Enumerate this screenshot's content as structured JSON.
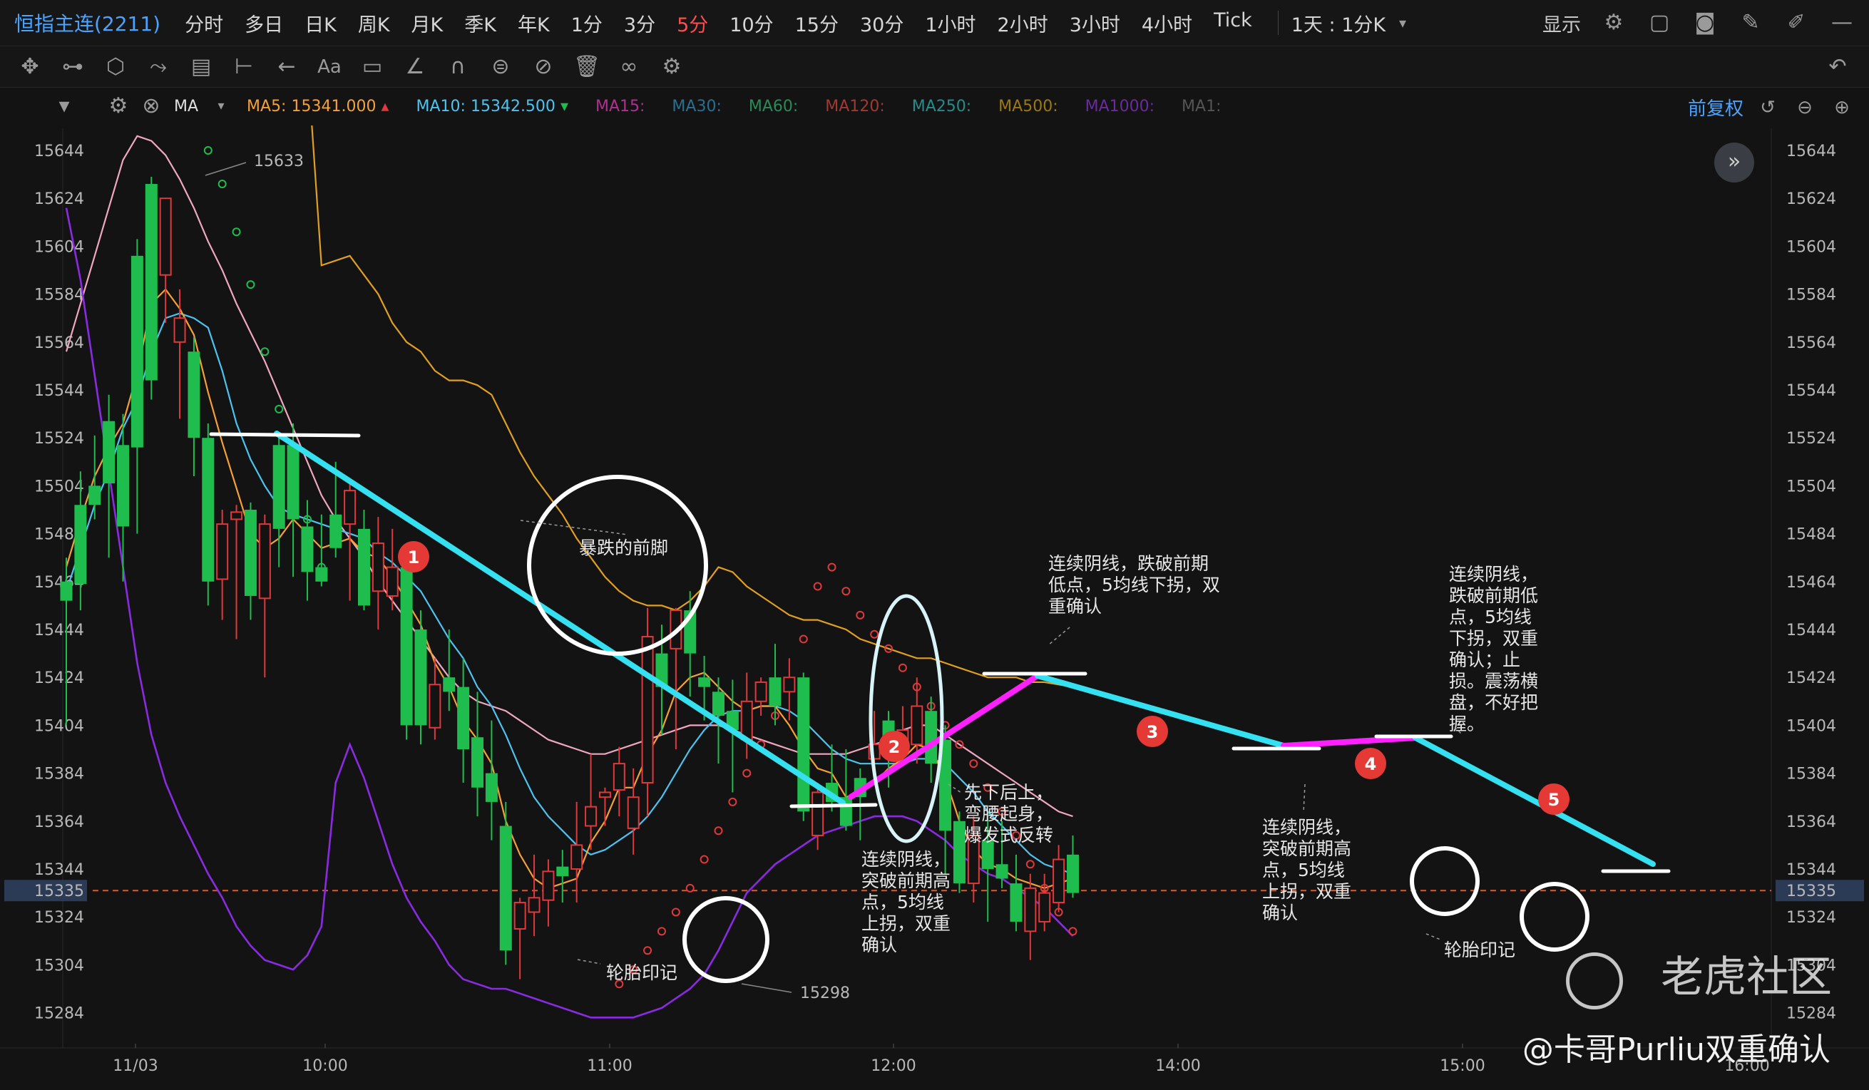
{
  "header": {
    "title": "恒指主连(2211)",
    "timeframes": [
      "分时",
      "多日",
      "日K",
      "周K",
      "月K",
      "季K",
      "年K",
      "1分",
      "3分",
      "5分",
      "10分",
      "15分",
      "30分",
      "1小时",
      "2小时",
      "3小时",
      "4小时",
      "Tick"
    ],
    "active_timeframe": "5分",
    "period_select": "1天 : 1分K",
    "display_label": "显示"
  },
  "mabar": {
    "ma_label": "MA",
    "ma5_label": "MA5:",
    "ma5_value": "15341.000",
    "ma10_label": "MA10:",
    "ma10_value": "15342.500",
    "others": [
      "MA15:",
      "MA30:",
      "MA60:",
      "MA120:",
      "MA250:",
      "MA500:",
      "MA1000:",
      "MA1:"
    ],
    "fuquan": "前复权"
  },
  "colors": {
    "up": "#e0393b",
    "down": "#1ebd4d",
    "ma5": "#f5a136",
    "ma10": "#4dc3f0",
    "ma_pink": "#f0a8c0",
    "ma_gold": "#e0a020",
    "ma_purple": "#8a2be2",
    "trend_cyan": "#35e0f0",
    "trend_magenta": "#ff20ff",
    "price_line": "#e0582a"
  },
  "chart_data": {
    "type": "candlestick",
    "y_ticks": [
      15644,
      15624,
      15604,
      15584,
      15564,
      15544,
      15524,
      15504,
      15484,
      15464,
      15444,
      15424,
      15404,
      15384,
      15364,
      15344,
      15324,
      15304,
      15284
    ],
    "x_ticks": [
      "11/03",
      "10:00",
      "11:00",
      "12:00",
      "14:00",
      "15:00",
      "16:00"
    ],
    "current_price": 15335,
    "current_price_label": "15335",
    "ylim": [
      15276,
      15652
    ],
    "bars": 72,
    "max_label": "15633",
    "min_label": "15298",
    "candles": [
      [
        15464,
        15456,
        15474,
        15404
      ],
      [
        15496,
        15463,
        15510,
        15452
      ],
      [
        15504,
        15496,
        15525,
        15490
      ],
      [
        15531,
        15505,
        15542,
        15474
      ],
      [
        15521,
        15487,
        15534,
        15464
      ],
      [
        15600,
        15520,
        15607,
        15484
      ],
      [
        15630,
        15548,
        15633,
        15540
      ],
      [
        15592,
        15624,
        15624,
        15572
      ],
      [
        15564,
        15574,
        15586,
        15532
      ],
      [
        15560,
        15524,
        15566,
        15508
      ],
      [
        15524,
        15464,
        15530,
        15454
      ],
      [
        15465,
        15488,
        15494,
        15448
      ],
      [
        15490,
        15493,
        15496,
        15440
      ],
      [
        15494,
        15458,
        15497,
        15448
      ],
      [
        15457,
        15488,
        15492,
        15424
      ],
      [
        15521,
        15486,
        15524,
        15470
      ],
      [
        15521,
        15490,
        15530,
        15466
      ],
      [
        15487,
        15468,
        15498,
        15456
      ],
      [
        15470,
        15464,
        15492,
        15462
      ],
      [
        15492,
        15478,
        15514,
        15474
      ],
      [
        15488,
        15502,
        15507,
        15456
      ],
      [
        15486,
        15454,
        15494,
        15452
      ],
      [
        15460,
        15480,
        15491,
        15444
      ],
      [
        15458,
        15470,
        15486,
        15452
      ],
      [
        15470,
        15404,
        15480,
        15398
      ],
      [
        15444,
        15404,
        15452,
        15396
      ],
      [
        15403,
        15421,
        15432,
        15398
      ],
      [
        15424,
        15418,
        15444,
        15410
      ],
      [
        15420,
        15394,
        15432,
        15380
      ],
      [
        15399,
        15378,
        15418,
        15366
      ],
      [
        15384,
        15372,
        15406,
        15356
      ],
      [
        15362,
        15310,
        15372,
        15304
      ],
      [
        15319,
        15330,
        15332,
        15298
      ],
      [
        15326,
        15332,
        15350,
        15316
      ],
      [
        15331,
        15343,
        15348,
        15320
      ],
      [
        15345,
        15341,
        15352,
        15330
      ],
      [
        15344,
        15354,
        15372,
        15330
      ],
      [
        15362,
        15370,
        15392,
        15352
      ],
      [
        15374,
        15376,
        15378,
        15362
      ],
      [
        15377,
        15388,
        15395,
        15366
      ],
      [
        15361,
        15374,
        15386,
        15350
      ],
      [
        15380,
        15441,
        15453,
        15366
      ],
      [
        15434,
        15420,
        15446,
        15400
      ],
      [
        15436,
        15452,
        15453,
        15394
      ],
      [
        15452,
        15434,
        15460,
        15416
      ],
      [
        15424,
        15420,
        15433,
        15406
      ],
      [
        15418,
        15408,
        15424,
        15388
      ],
      [
        15410,
        15402,
        15423,
        15376
      ],
      [
        15398,
        15414,
        15426,
        15390
      ],
      [
        15414,
        15422,
        15424,
        15408
      ],
      [
        15424,
        15412,
        15438,
        15404
      ],
      [
        15418,
        15424,
        15432,
        15406
      ],
      [
        15424,
        15368,
        15426,
        15364
      ],
      [
        15358,
        15376,
        15380,
        15352
      ],
      [
        15380,
        15372,
        15396,
        15368
      ],
      [
        15374,
        15362,
        15394,
        15360
      ],
      [
        15382,
        15374,
        15386,
        15356
      ],
      [
        15390,
        15396,
        15410,
        15380
      ],
      [
        15406,
        15392,
        15410,
        15378
      ],
      [
        15398,
        15402,
        15412,
        15392
      ],
      [
        15396,
        15412,
        15424,
        15388
      ],
      [
        15410,
        15388,
        15416,
        15380
      ],
      [
        15398,
        15360,
        15404,
        15342
      ],
      [
        15364,
        15338,
        15368,
        15334
      ],
      [
        15338,
        15358,
        15366,
        15330
      ],
      [
        15356,
        15344,
        15368,
        15322
      ],
      [
        15346,
        15340,
        15364,
        15336
      ],
      [
        15338,
        15322,
        15350,
        15318
      ],
      [
        15318,
        15336,
        15342,
        15306
      ],
      [
        15322,
        15334,
        15342,
        15318
      ],
      [
        15330,
        15348,
        15354,
        15326
      ],
      [
        15350,
        15334,
        15358,
        15332
      ]
    ],
    "lines": {
      "ma5": [
        15470,
        15490,
        15508,
        15520,
        15530,
        15551,
        15580,
        15586,
        15578,
        15567,
        15543,
        15522,
        15503,
        15484,
        15478,
        15482,
        15490,
        15484,
        15478,
        15480,
        15482,
        15476,
        15474,
        15466,
        15456,
        15446,
        15430,
        15420,
        15406,
        15398,
        15388,
        15364,
        15350,
        15340,
        15336,
        15338,
        15340,
        15355,
        15364,
        15378,
        15378,
        15392,
        15402,
        15418,
        15424,
        15426,
        15420,
        15414,
        15410,
        15412,
        15412,
        15404,
        15394,
        15386,
        15384,
        15374,
        15376,
        15380,
        15386,
        15390,
        15396,
        15394,
        15382,
        15364,
        15352,
        15346,
        15344,
        15340,
        15338,
        15336,
        15338,
        15340
      ],
      "ma10": [
        15460,
        15478,
        15496,
        15510,
        15528,
        15540,
        15560,
        15574,
        15576,
        15574,
        15570,
        15552,
        15530,
        15515,
        15504,
        15495,
        15492,
        15490,
        15488,
        15486,
        15484,
        15482,
        15476,
        15472,
        15466,
        15460,
        15450,
        15440,
        15432,
        15420,
        15412,
        15400,
        15386,
        15374,
        15366,
        15360,
        15354,
        15350,
        15352,
        15356,
        15360,
        15366,
        15374,
        15384,
        15394,
        15402,
        15408,
        15410,
        15410,
        15412,
        15412,
        15410,
        15406,
        15400,
        15394,
        15390,
        15388,
        15388,
        15388,
        15388,
        15390,
        15390,
        15388,
        15382,
        15376,
        15368,
        15362,
        15356,
        15350,
        15346,
        15344,
        15342
      ],
      "ma_pink": [
        15560,
        15580,
        15600,
        15620,
        15640,
        15650,
        15648,
        15642,
        15632,
        15620,
        15606,
        15594,
        15580,
        15568,
        15556,
        15542,
        15528,
        15514,
        15500,
        15490,
        15482,
        15474,
        15464,
        15456,
        15448,
        15440,
        15432,
        15424,
        15418,
        15414,
        15412,
        15410,
        15406,
        15402,
        15398,
        15396,
        15394,
        15392,
        15392,
        15394,
        15396,
        15398,
        15400,
        15402,
        15404,
        15404,
        15404,
        15402,
        15400,
        15398,
        15396,
        15394,
        15392,
        15392,
        15392,
        15392,
        15394,
        15396,
        15398,
        15402,
        15404,
        15404,
        15400,
        15396,
        15392,
        15388,
        15384,
        15380,
        15376,
        15372,
        15368,
        15366
      ],
      "ma_gold": [
        15700,
        15700,
        15700,
        15700,
        15700,
        15700,
        15700,
        15700,
        15700,
        15700,
        15700,
        15700,
        15700,
        15700,
        15700,
        15700,
        15700,
        15682,
        15596,
        15598,
        15600,
        15592,
        15584,
        15572,
        15564,
        15560,
        15552,
        15548,
        15548,
        15546,
        15542,
        15530,
        15518,
        15508,
        15500,
        15492,
        15482,
        15474,
        15466,
        15460,
        15456,
        15454,
        15454,
        15452,
        15456,
        15462,
        15470,
        15468,
        15462,
        15458,
        15454,
        15450,
        15448,
        15448,
        15446,
        15444,
        15440,
        15438,
        15436,
        15434,
        15432,
        15432,
        15430,
        15428,
        15426,
        15424,
        15424,
        15424,
        15422,
        15422,
        15421,
        15420
      ],
      "ma_purple": [
        15620,
        15590,
        15550,
        15510,
        15470,
        15430,
        15400,
        15380,
        15366,
        15354,
        15342,
        15332,
        15320,
        15312,
        15306,
        15304,
        15302,
        15308,
        15320,
        15380,
        15396,
        15382,
        15364,
        15346,
        15332,
        15322,
        15314,
        15304,
        15298,
        15296,
        15294,
        15294,
        15292,
        15290,
        15288,
        15286,
        15284,
        15282,
        15282,
        15282,
        15282,
        15284,
        15286,
        15290,
        15294,
        15300,
        15310,
        15322,
        15334,
        15340,
        15346,
        15350,
        15354,
        15358,
        15360,
        15362,
        15364,
        15366,
        15366,
        15366,
        15364,
        15360,
        15356,
        15350,
        15346,
        15342,
        15340,
        15336,
        15332,
        15328,
        15322,
        15316
      ],
      "sar": [
        [
          10,
          15644
        ],
        [
          11,
          15630
        ],
        [
          12,
          15610
        ],
        [
          13,
          15588
        ],
        [
          14,
          15560
        ],
        [
          15,
          15536
        ],
        [
          16,
          15510
        ],
        [
          17,
          15490
        ],
        [
          18,
          15470
        ],
        [
          39,
          15296
        ],
        [
          40,
          15302
        ],
        [
          41,
          15310
        ],
        [
          42,
          15318
        ],
        [
          43,
          15326
        ],
        [
          44,
          15336
        ],
        [
          45,
          15348
        ],
        [
          46,
          15360
        ],
        [
          47,
          15372
        ],
        [
          48,
          15384
        ],
        [
          49,
          15396
        ],
        [
          50,
          15408
        ],
        [
          51,
          15422
        ],
        [
          52,
          15440
        ],
        [
          53,
          15462
        ],
        [
          54,
          15470
        ],
        [
          55,
          15460
        ],
        [
          56,
          15450
        ],
        [
          57,
          15442
        ],
        [
          58,
          15436
        ],
        [
          59,
          15428
        ],
        [
          60,
          15420
        ],
        [
          61,
          15412
        ],
        [
          62,
          15404
        ],
        [
          63,
          15396
        ],
        [
          64,
          15388
        ],
        [
          65,
          15378
        ],
        [
          66,
          15368
        ],
        [
          67,
          15358
        ],
        [
          68,
          15346
        ],
        [
          69,
          15336
        ],
        [
          70,
          15326
        ],
        [
          71,
          15318
        ]
      ]
    },
    "annotations": [
      {
        "id": "a1",
        "text": "暴跌的前脚"
      },
      {
        "id": "a2",
        "text": "轮胎印记"
      },
      {
        "id": "a3",
        "lines": [
          "连续阴线，",
          "突破前期高",
          "点，5均线",
          "上拐，双重",
          "确认"
        ]
      },
      {
        "id": "a4",
        "lines": [
          "先下后上，",
          "弯腰起身，",
          "爆发式反转"
        ]
      },
      {
        "id": "a5",
        "lines": [
          "连续阴线，跌破前期",
          "低点，5均线下拐，双",
          "重确认"
        ]
      },
      {
        "id": "a6",
        "lines": [
          "连续阴线，",
          "突破前期高",
          "点，5均线",
          "上拐，双重",
          "确认"
        ]
      },
      {
        "id": "a7",
        "lines": [
          "连续阴线，",
          "跌破前期低",
          "点，5均线",
          "下拐，双重",
          "确认；止",
          "损。震荡横",
          "盘，不好把",
          "握。"
        ]
      },
      {
        "id": "a8",
        "text": "轮胎印记"
      }
    ],
    "markers": [
      "1",
      "2",
      "3",
      "4",
      "5"
    ]
  },
  "watermark": "老虎社区",
  "signature": "@卡哥Purliu双重确认"
}
